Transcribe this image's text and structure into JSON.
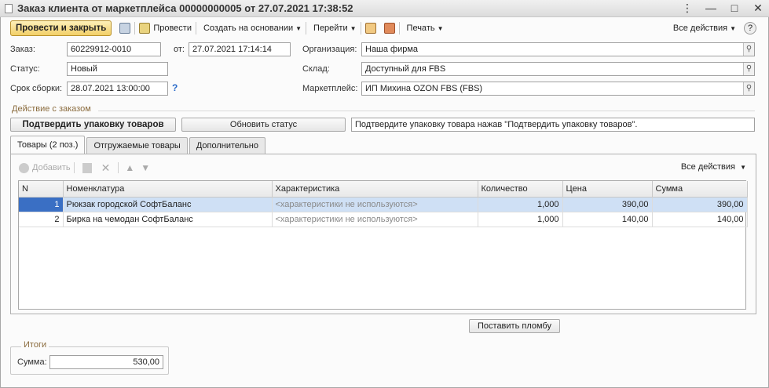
{
  "window": {
    "title": "Заказ клиента от маркетплейса 00000000005 от 27.07.2021 17:38:52",
    "controls": {
      "menu": "⋮",
      "minimize": "—",
      "maximize": "□",
      "close": "✕"
    }
  },
  "toolbar": {
    "post_and_close": "Провести и закрыть",
    "post": "Провести",
    "create_based_on": "Создать на основании",
    "go_to": "Перейти",
    "print": "Печать",
    "all_actions": "Все действия",
    "help": "?"
  },
  "form": {
    "order_label": "Заказ:",
    "order_value": "60229912-0010",
    "from_label": "от:",
    "from_value": "27.07.2021 17:14:14",
    "status_label": "Статус:",
    "status_value": "Новый",
    "deadline_label": "Срок сборки:",
    "deadline_value": "28.07.2021 13:00:00",
    "deadline_help": "?",
    "org_label": "Организация:",
    "org_value": "Наша фирма",
    "warehouse_label": "Склад:",
    "warehouse_value": "Доступный для FBS",
    "marketplace_label": "Маркетплейс:",
    "marketplace_value": "ИП Михина OZON FBS (FBS)",
    "lookup_icon": "search-icon"
  },
  "order_action": {
    "group_title": "Действие с заказом",
    "confirm_button": "Подтвердить упаковку товаров",
    "refresh_button": "Обновить статус",
    "hint": "Подтвердите упаковку товара нажав \"Подтвердить упаковку товаров\"."
  },
  "tabs": [
    {
      "label": "Товары (2 поз.)",
      "active": true
    },
    {
      "label": "Отгружаемые товары",
      "active": false
    },
    {
      "label": "Дополнительно",
      "active": false
    }
  ],
  "goods": {
    "add_label": "Добавить",
    "all_actions": "Все действия",
    "columns": [
      "N",
      "Номенклатура",
      "Характеристика",
      "Количество",
      "Цена",
      "Сумма"
    ],
    "rows": [
      {
        "n": "1",
        "item": "Рюкзак городской СофтБаланс",
        "characteristic": "<характеристики не используются>",
        "qty": "1,000",
        "price": "390,00",
        "sum": "390,00"
      },
      {
        "n": "2",
        "item": "Бирка на чемодан СофтБаланс",
        "characteristic": "<характеристики не используются>",
        "qty": "1,000",
        "price": "140,00",
        "sum": "140,00"
      }
    ]
  },
  "seal_button": "Поставить пломбу",
  "totals": {
    "group_title": "Итоги",
    "sum_label": "Сумма:",
    "sum_value": "530,00"
  },
  "colors": {
    "accent_button": "#f2cf68",
    "selected_row": "#cfe0f5",
    "selected_cell": "#3a6fc4",
    "group_title": "#8a6b3d"
  }
}
